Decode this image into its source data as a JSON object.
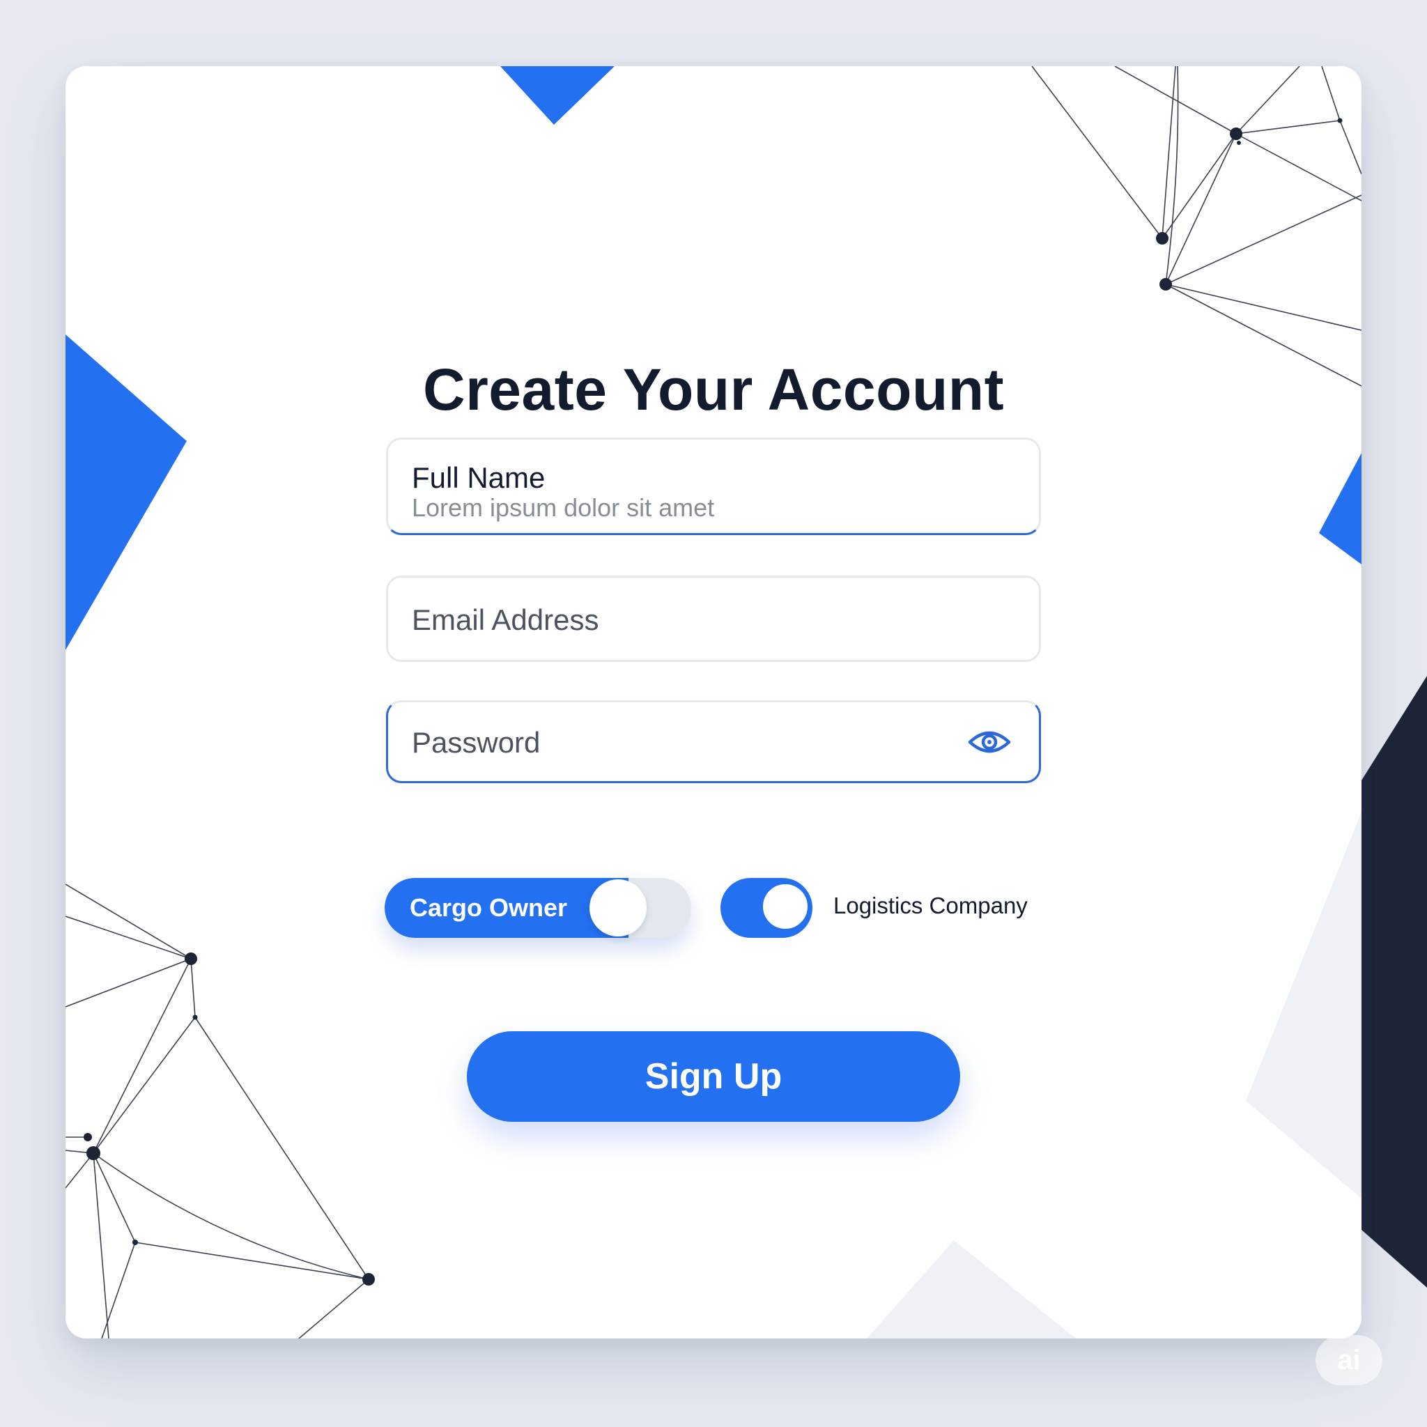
{
  "form": {
    "title": "Create Your Account",
    "full_name": {
      "label": "Full Name",
      "value": "Lorem ipsum dolor sit amet"
    },
    "email": {
      "placeholder": "Email Address"
    },
    "password": {
      "placeholder": "Password"
    },
    "account_type": {
      "option_1": "Cargo Owner",
      "option_2": "Logistics Company"
    },
    "submit_label": "Sign Up"
  },
  "badge": "ai",
  "icons": {
    "password_toggle": "eye-icon"
  },
  "colors": {
    "accent": "#2370f0",
    "navy": "#1c2436",
    "title": "#131c2e",
    "background": "#e6eaf0",
    "card": "#ffffff"
  }
}
